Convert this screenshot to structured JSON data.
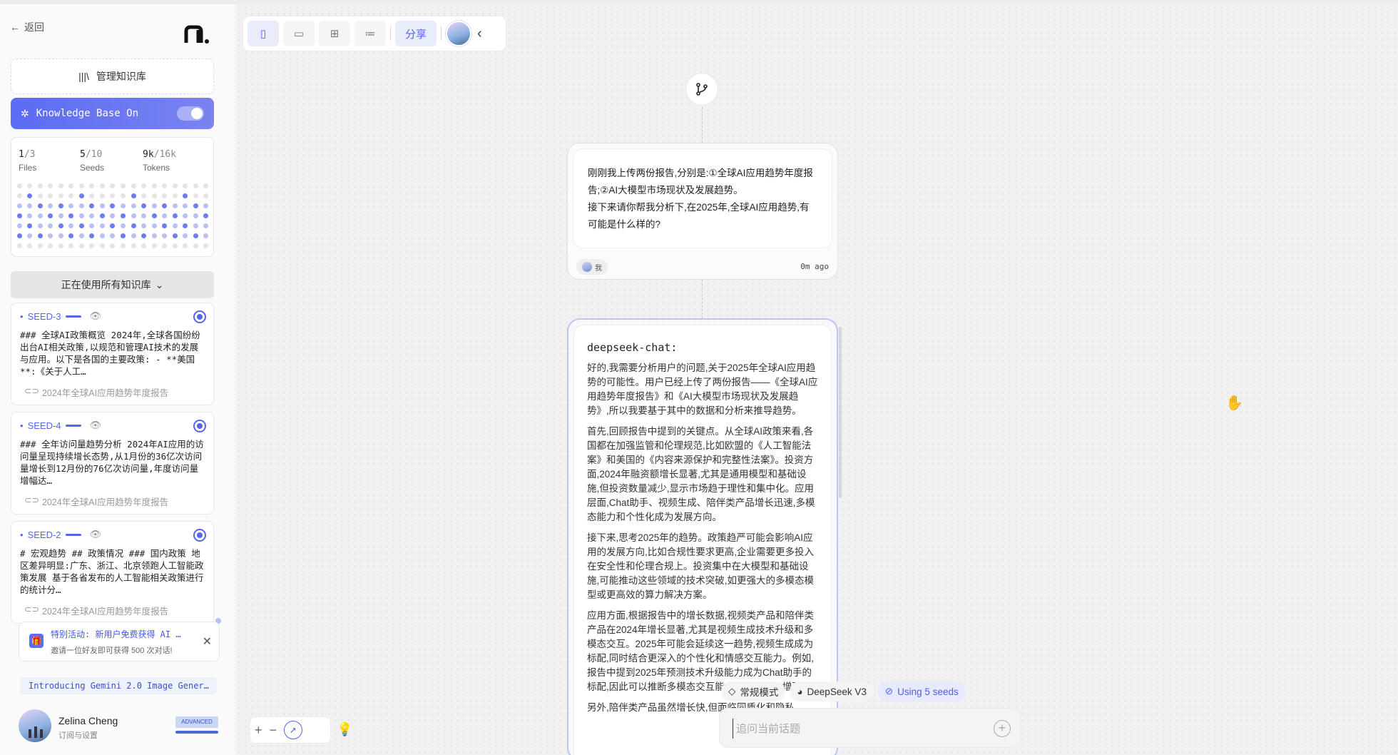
{
  "sidebar": {
    "back": "返回",
    "manage": "管理知识库",
    "kb_toggle": "Knowledge Base On",
    "stats": [
      {
        "value": "1",
        "total": "/3",
        "label": "Files"
      },
      {
        "value": "5",
        "total": "/10",
        "label": "Seeds"
      },
      {
        "value": "9k",
        "total": "/16k",
        "label": "Tokens"
      }
    ],
    "using_all": "正在使用所有知识库",
    "seeds": [
      {
        "title": "SEED-3",
        "body": "### 全球AI政策概览 2024年,全球各国纷纷出台AI相关政策,以规范和管理AI技术的发展与应用。以下是各国的主要政策: - **美国**:《关于人工…",
        "source": "2024年全球AI应用趋势年度报告"
      },
      {
        "title": "SEED-4",
        "body": "### 全年访问量趋势分析 2024年AI应用的访问量呈现持续增长态势,从1月份的36亿次访问量增长到12月份的76亿次访问量,年度访问量增幅达…",
        "source": "2024年全球AI应用趋势年度报告"
      },
      {
        "title": "SEED-2",
        "body": "# 宏观趋势 ## 政策情况 ### 国内政策 地区差异明显:广东、浙江、北京领跑人工智能政策发展 基于各省发布的人工智能相关政策进行的统计分…",
        "source": "2024年全球AI应用趋势年度报告"
      }
    ],
    "promo_title": "特别活动: 新用户免费获得 AI …",
    "promo_sub": "邀请一位好友即可获得 500 次对话!",
    "gemini": "Introducing Gemini 2.0 Image Gener…",
    "user_name": "Zelina Cheng",
    "user_sub": "订阅与设置",
    "badge": "ADVANCED"
  },
  "toolbar": {
    "share": "分享"
  },
  "messages": {
    "user_text_1": "刚刚我上传两份报告,分别是:①全球AI应用趋势年度报告;②AI大模型市场现状及发展趋势。",
    "user_text_2": "接下来请你帮我分析下,在2025年,全球AI应用趋势,有可能是什么样的?",
    "user_label": "我",
    "time": "0m ago",
    "model": "deepseek-chat:",
    "paragraphs": [
      "好的,我需要分析用户的问题,关于2025年全球AI应用趋势的可能性。用户已经上传了两份报告——《全球AI应用趋势年度报告》和《AI大模型市场现状及发展趋势》,所以我要基于其中的数据和分析来推导趋势。",
      "首先,回顾报告中提到的关键点。从全球AI政策来看,各国都在加强监管和伦理规范,比如欧盟的《人工智能法案》和美国的《内容来源保护和完整性法案》。投资方面,2024年融资额增长显著,尤其是通用模型和基础设施,但投资数量减少,显示市场趋于理性和集中化。应用层面,Chat助手、视频生成、陪伴类产品增长迅速,多模态能力和个性化成为发展方向。",
      "接下来,思考2025年的趋势。政策趋严可能会影响AI应用的发展方向,比如合规性要求更高,企业需要更多投入在安全性和伦理合规上。投资集中在大模型和基础设施,可能推动这些领域的技术突破,如更强大的多模态模型或更高效的算力解决方案。",
      "应用方面,根据报告中的增长数据,视频类产品和陪伴类产品在2024年增长显著,尤其是视频生成技术升级和多模态交互。2025年可能会延续这一趋势,视频生成成为标配,同时结合更深入的个性化和情感交互能力。例如,报告中提到2025年预测技术升级能力成为Chat助手的标配,因此可以推断多模态交互能力将会进一步增强。",
      "另外,陪伴类产品虽然增长快,但面临同质化和隐私"
    ]
  },
  "composer": {
    "mode": "常规模式",
    "model": "DeepSeek V3",
    "seeds": "Using 5 seeds",
    "placeholder": "追问当前话题"
  }
}
